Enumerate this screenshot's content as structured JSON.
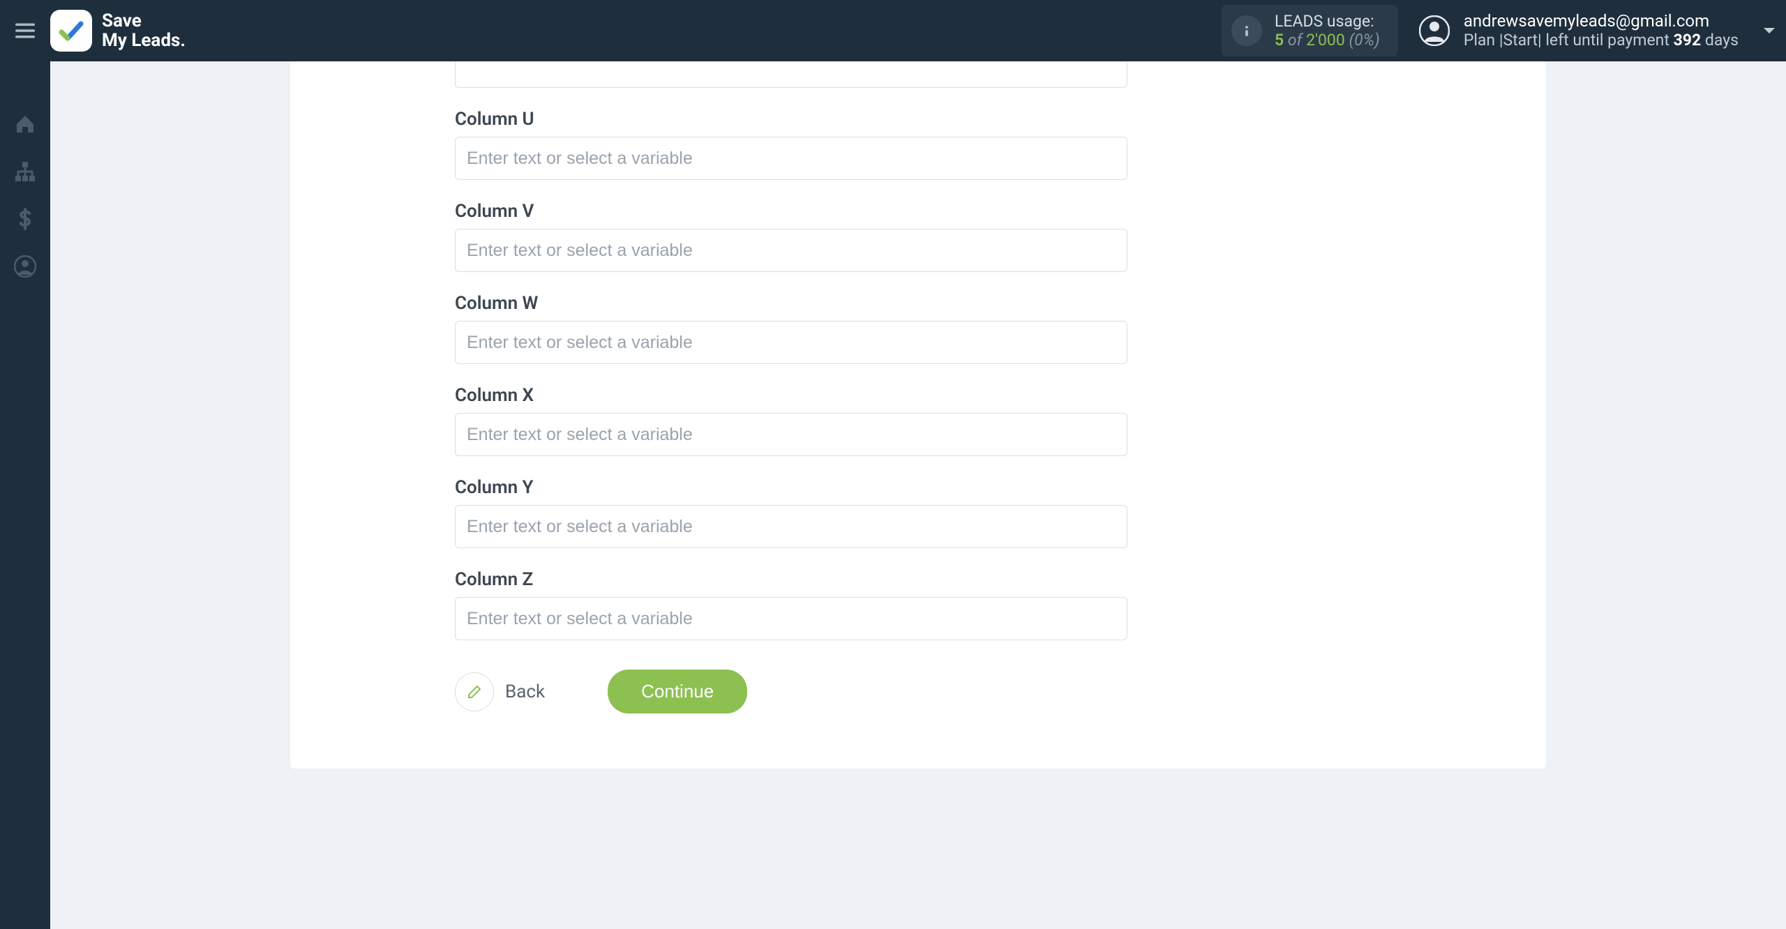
{
  "colors": {
    "accent": "#8cc152",
    "topbar": "#1f2e3d",
    "bg": "#eef1f5"
  },
  "brand": {
    "line1": "Save",
    "line2": "My Leads."
  },
  "usage": {
    "label": "LEADS usage:",
    "used": "5",
    "of_word": "of",
    "limit": "2'000",
    "pct": "(0%)"
  },
  "account": {
    "email": "andrewsavemyleads@gmail.com",
    "plan_prefix": "Plan |Start| left until payment",
    "days_count": "392",
    "days_word": "days"
  },
  "sidebar": {
    "items": [
      {
        "name": "home"
      },
      {
        "name": "sitemap"
      },
      {
        "name": "billing"
      },
      {
        "name": "account"
      }
    ]
  },
  "form": {
    "placeholder": "Enter text or select a variable",
    "fields": [
      {
        "label": "Column U"
      },
      {
        "label": "Column V"
      },
      {
        "label": "Column W"
      },
      {
        "label": "Column X"
      },
      {
        "label": "Column Y"
      },
      {
        "label": "Column Z"
      }
    ],
    "back_label": "Back",
    "continue_label": "Continue"
  }
}
